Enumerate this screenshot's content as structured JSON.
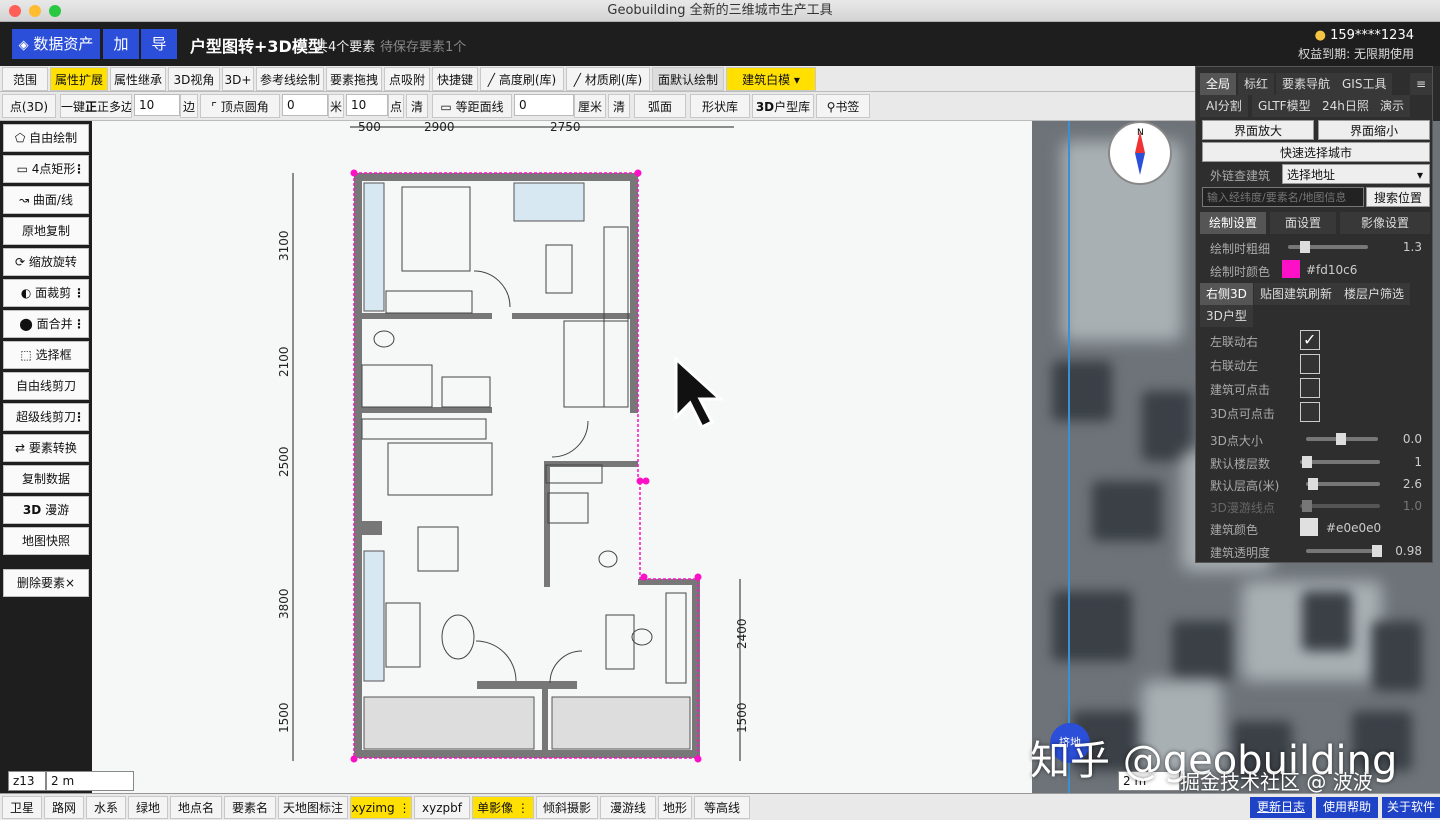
{
  "window_title": "Geobuilding 全新的三维城市生产工具",
  "header": {
    "data_assets": "数据资产",
    "add": "加",
    "export": "导",
    "title": "户型图转+3D模型",
    "count": "共4个要素",
    "pending": "待保存要素1个",
    "user": "159****1234",
    "expiry": "权益到期: 无限期使用"
  },
  "toolbar1": [
    "范围",
    "属性扩展",
    "属性继承",
    "3D视角",
    "3D+",
    "参考线绘制",
    "要素拖拽",
    "点吸附",
    "快捷键",
    "高度刷(库)",
    "材质刷(库)",
    "面默认绘制",
    "建筑白模"
  ],
  "toolbar2": {
    "point3d": "点(3D)",
    "one_key": "一键",
    "polygon": "正多边",
    "sides_value": "10",
    "sides_unit": "边",
    "corner": "顶点圆角",
    "corner_value": "0",
    "corner_unit": "米",
    "point_value": "10",
    "point_unit": "点",
    "clear1": "清",
    "equal_line": "等距面线",
    "equal_value": "0",
    "equal_unit": "厘米",
    "clear2": "清",
    "arc": "弧面",
    "shape_lib": "形状库",
    "house_lib": "户型库",
    "house_3d": "3D",
    "bookmark": "书签"
  },
  "left_tools": [
    "自由绘制",
    "4点矩形",
    "曲面/线",
    "原地复制",
    "缩放旋转",
    "面裁剪",
    "面合并",
    "选择框",
    "自由线剪刀",
    "超级线剪刀",
    "要素转换",
    "复制数据",
    "漫游",
    "地图快照",
    "删除要素×"
  ],
  "roam_3d": "3D",
  "panel": {
    "tabs1": [
      "全局",
      "标红",
      "要素导航",
      "GIS工具"
    ],
    "tabs2": [
      "AI分割",
      "GLTF模型",
      "24h日照",
      "演示"
    ],
    "zoom_in": "界面放大",
    "zoom_out": "界面缩小",
    "quick_city": "快速选择城市",
    "ext_building": "外链查建筑",
    "select_addr": "选择地址",
    "search_placeholder": "输入经纬度/要素名/地图信息",
    "search_btn": "搜索位置",
    "tabs3": [
      "绘制设置",
      "面设置",
      "影像设置"
    ],
    "stroke_label": "绘制时粗细",
    "stroke_value": "1.3",
    "color_label": "绘制时颜色",
    "draw_color": "#fd10c6",
    "tabs4": [
      "右侧3D",
      "贴图建筑刷新",
      "楼层户筛选"
    ],
    "tab_3d_house": "3D户型",
    "options": [
      "左联动右",
      "右联动左",
      "建筑可点击",
      "3D点可点击"
    ],
    "checked": [
      true,
      false,
      false,
      false
    ],
    "point_size_label": "3D点大小",
    "point_size": "0.0",
    "floors_label": "默认楼层数",
    "floors": "1",
    "floor_h_label": "默认层高(米)",
    "floor_h": "2.6",
    "roam_label": "3D漫游线点",
    "roam": "1.0",
    "bcolor_label": "建筑颜色",
    "building_color": "#e0e0e0",
    "opacity_label": "建筑透明度",
    "opacity": "0.98"
  },
  "dims": {
    "top": [
      "500",
      "2900",
      "2750"
    ],
    "left": [
      "3100",
      "2100",
      "2500",
      "3800",
      "1500"
    ],
    "right": [
      "2400",
      "1500"
    ]
  },
  "map_overlay": {
    "north": "N",
    "float_btn": "挤地"
  },
  "bottom": [
    "卫星",
    "路网",
    "水系",
    "绿地",
    "地点名",
    "要素名",
    "天地图标注",
    "xyzimg",
    "xyzpbf",
    "单影像",
    "倾斜摄影",
    "漫游线",
    "地形",
    "等高线"
  ],
  "bottom_right": [
    "更新日志",
    "使用帮助",
    "关于软件"
  ],
  "zoom": {
    "level": "z13",
    "scale_left": "2 m",
    "scale_right": "2 m"
  },
  "watermark": {
    "zhihu": "知乎 @geobuilding",
    "juejin": "掘金技术社区 @ 波波"
  }
}
